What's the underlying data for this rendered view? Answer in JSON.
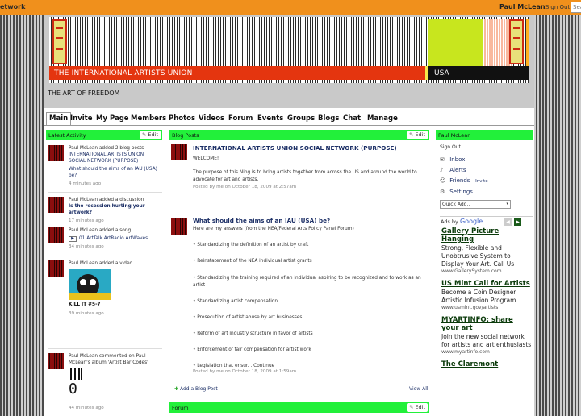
{
  "topbar": {
    "network_name": "etwork",
    "user_name": "Paul McLean",
    "sign_out": "Sign Out",
    "search_placeholder": "Sea"
  },
  "header": {
    "banner_title": "THE INTERNATIONAL ARTISTS UNION",
    "banner_country": "USA",
    "tagline": "THE ART OF FREEDOM",
    "colors": {
      "red": "#e4350f",
      "yellow_green": "#c8e61e",
      "green": "#22f03a",
      "orange": "#f0901c"
    }
  },
  "nav": {
    "tabs": [
      "Main",
      "Invite",
      "My Page",
      "Members",
      "Photos",
      "Videos",
      "Forum",
      "Events",
      "Groups",
      "Blogs",
      "Chat",
      "Manage"
    ],
    "active": "Main"
  },
  "activity": {
    "title": "Latest Activity",
    "edit_label": "Edit",
    "items": [
      {
        "line1": "Paul McLean added 2 blog posts",
        "link1": "INTERNATIONAL ARTISTS UNION SOCIAL NETWORK (PURPOSE)",
        "link2": "What should the aims of an IAU (USA) be?",
        "time": "4 minutes ago"
      },
      {
        "line1": "Paul McLean added a discussion",
        "link1": "Is the recession hurting your artwork?",
        "time": "17 minutes ago"
      },
      {
        "line1": "Paul McLean added a song",
        "link1": "01 ArtTalk ArtRadio ArtWaves",
        "time": "34 minutes ago"
      },
      {
        "line1": "Paul McLean added a video",
        "link1": "KILL IT #5-7",
        "time": "39 minutes ago"
      },
      {
        "line1": "Paul McLean commented on Paul McLean's album 'Artist Bar Codes'",
        "digit": "0",
        "time": "44 minutes ago"
      }
    ]
  },
  "blog": {
    "title": "Blog Posts",
    "edit_label": "Edit",
    "posts": [
      {
        "title": "INTERNATIONAL ARTISTS UNION SOCIAL NETWORK (PURPOSE)",
        "body": [
          "WELCOME!",
          "The purpose of this Ning is to bring artists together from across the US and around the world to advocate for art and artists."
        ],
        "meta": "Posted by me on October 18, 2009 at 2:57am"
      },
      {
        "title": "What should the aims of an IAU (USA) be?",
        "body": [
          "Here are my answers (from the NEA/Federal Arts Policy Panel Forum)",
          "• Standardizing the definition of an artist by craft",
          "• Reinstatement of the NEA individual artist grants",
          "• Standardizing the training required of an individual aspiring to be recognized and to work as an artist",
          "• Standardizing artist compensation",
          "• Prosecution of artist abuse by art businesses",
          "• Reform of art industry structure in favor of artists",
          "• Enforcement of fair compensation for artist work",
          "• Legislation that ensur. . Continue"
        ],
        "meta": "Posted by me on October 18, 2009 at 1:59am"
      }
    ],
    "add_label": "Add a Blog Post",
    "view_all": "View All"
  },
  "forum": {
    "title": "Forum",
    "edit_label": "Edit"
  },
  "sidebar": {
    "title": "Paul McLean",
    "sign_out": "Sign Out",
    "links": [
      "Inbox",
      "Alerts",
      "Friends",
      "Settings"
    ],
    "invite": "– Invite",
    "quick_add": "Quick Add..",
    "ads_by": "Ads by",
    "google": "Google",
    "ads": [
      {
        "title": "Gallery Picture Hanging",
        "body": "Strong, Flexible and Unobtrusive System to Display Your Art. Call Us",
        "url": "www.GallerySystem.com"
      },
      {
        "title": "US Mint Call for Artists",
        "body": "Become a Coin Designer Artistic Infusion Program",
        "url": "www.usmint.gov/artists"
      },
      {
        "title": "MYARTINFO: share your art",
        "body": "Join the new social network for artists and art enthusiasts",
        "url": "www.myartinfo.com"
      },
      {
        "title": "The Claremont"
      }
    ]
  }
}
